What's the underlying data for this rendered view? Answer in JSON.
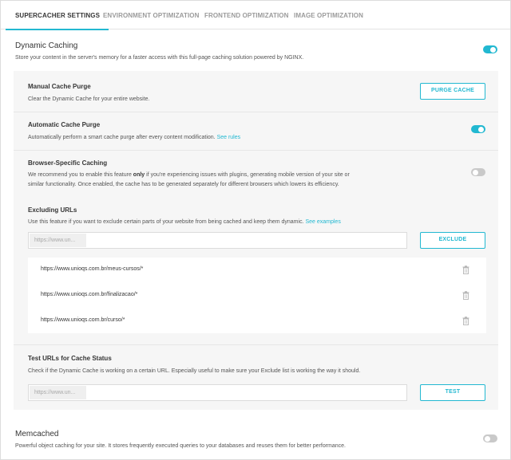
{
  "tabs": [
    {
      "label": "SUPERCACHER SETTINGS",
      "active": true
    },
    {
      "label": "ENVIRONMENT OPTIMIZATION",
      "active": false
    },
    {
      "label": "FRONTEND OPTIMIZATION",
      "active": false
    },
    {
      "label": "IMAGE OPTIMIZATION",
      "active": false
    }
  ],
  "dynamic_caching": {
    "title": "Dynamic Caching",
    "description": "Store your content in the server's memory for a faster access with this full-page caching solution powered by NGINX.",
    "enabled": true
  },
  "manual_purge": {
    "title": "Manual Cache Purge",
    "description": "Clear the Dynamic Cache for your entire website.",
    "button_label": "PURGE CACHE"
  },
  "automatic_purge": {
    "title": "Automatic Cache Purge",
    "description": "Automatically perform a smart cache purge after every content modification.",
    "link_label": "See rules",
    "enabled": true
  },
  "browser_specific": {
    "title": "Browser-Specific Caching",
    "desc_part1": "We recommend you to enable this feature",
    "desc_bold": "only",
    "desc_part2": "if you're experiencing issues with plugins, generating mobile version of your site or",
    "desc_line2": "similar functionality. Once enabled, the cache has to be generated separately for different browsers which lowers its efficiency.",
    "enabled": false
  },
  "excluding_urls": {
    "title": "Excluding URLs",
    "description": "Use this feature if you want to exclude certain parts of your website from being cached and keep them dynamic.",
    "link_label": "See examples",
    "input_prefix": "https://www.un...",
    "input_value": "",
    "button_label": "EXCLUDE",
    "urls": [
      "https://www.unioqs.com.br/meus-cursos/*",
      "https://www.unioqs.com.br/finalizacao/*",
      "https://www.unioqs.com.br/curso/*"
    ]
  },
  "test_urls": {
    "title": "Test URLs for Cache Status",
    "description": "Check if the Dynamic Cache is working on a certain URL. Especially useful to make sure your Exclude list is working the way it should.",
    "input_prefix": "https://www.un...",
    "input_value": "",
    "button_label": "TEST"
  },
  "memcached": {
    "title": "Memcached",
    "description": "Powerful object caching for your site. It stores frequently executed queries to your databases and reuses them for better performance.",
    "enabled": false
  },
  "colors": {
    "accent": "#22b8d1",
    "toggle_off": "#c9c9c9",
    "panel_bg": "#f6f6f6"
  },
  "icons": {
    "delete": "trash-icon"
  }
}
